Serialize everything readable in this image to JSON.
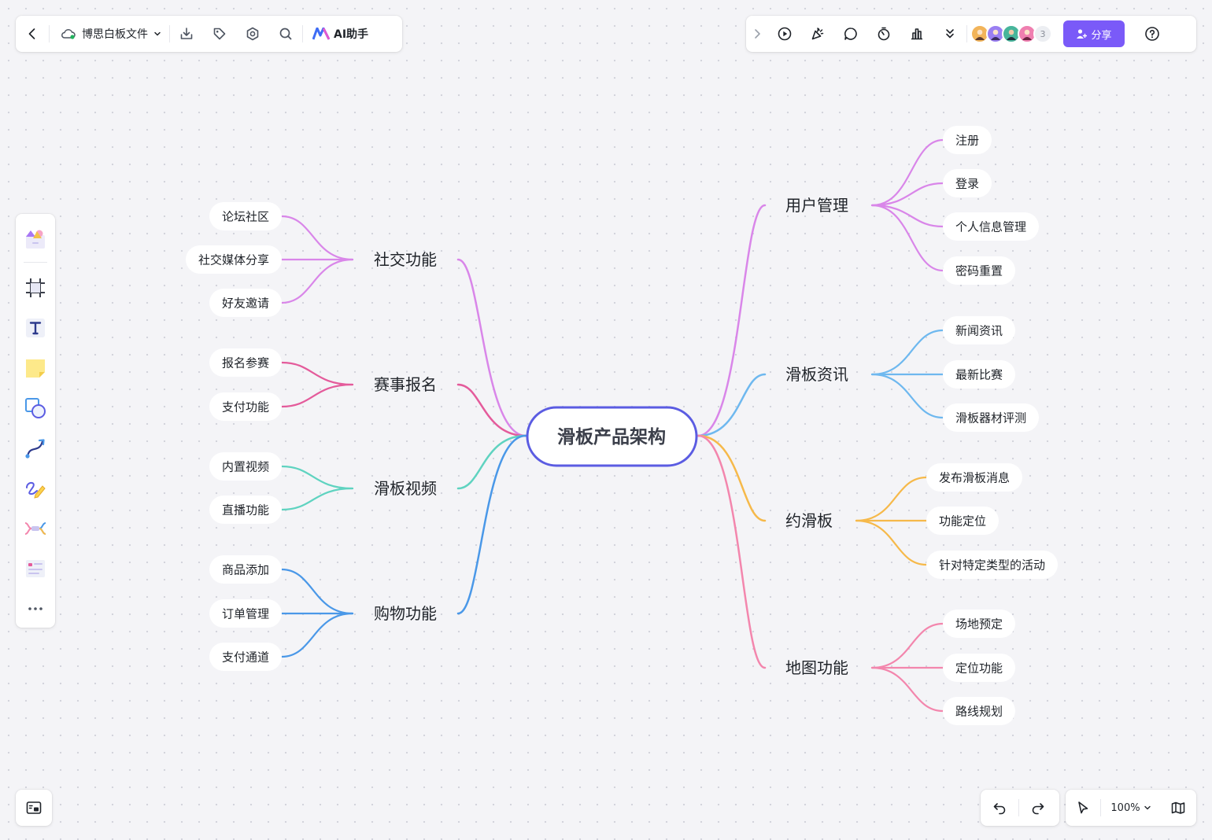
{
  "toolbar": {
    "file_title": "博思白板文件",
    "ai_label": "AI助手",
    "collaborator_count": "3",
    "share_label": "分享"
  },
  "zoom": {
    "level": "100%"
  },
  "colors": {
    "accent": "#7a5af8",
    "root_border": "#5b5ce2",
    "social": "#d986e9",
    "event": "#e45b9b",
    "video": "#5fd3c0",
    "shopping": "#4a98e8",
    "user": "#d986e9",
    "news": "#6eb8ef",
    "meetup": "#f6b94a",
    "map": "#f386ad"
  },
  "icons": {
    "toolbar_left": [
      "back-icon",
      "cloud-icon",
      "chevron-down-icon",
      "download-icon",
      "tag-icon",
      "settings-icon",
      "search-icon",
      "ai-logo-icon"
    ],
    "toolbar_right": [
      "expand-icon",
      "play-icon",
      "celebrate-icon",
      "comment-icon",
      "timer-icon",
      "chart-icon",
      "more-down-icon",
      "share-user-icon",
      "help-icon"
    ],
    "tools": [
      "template-icon",
      "frame-icon",
      "text-icon",
      "sticky-note-icon",
      "shape-icon",
      "connector-icon",
      "pen-icon",
      "mindmap-icon",
      "table-icon",
      "more-icon"
    ],
    "bottom": [
      "minimap-icon",
      "undo-icon",
      "redo-icon",
      "pointer-icon",
      "chevron-down-icon",
      "book-icon"
    ]
  },
  "mindmap": {
    "root": "滑板产品架构",
    "left": [
      {
        "label": "社交功能",
        "color": "#d986e9",
        "children": [
          "论坛社区",
          "社交媒体分享",
          "好友邀请"
        ]
      },
      {
        "label": "赛事报名",
        "color": "#e45b9b",
        "children": [
          "报名参赛",
          "支付功能"
        ]
      },
      {
        "label": "滑板视频",
        "color": "#5fd3c0",
        "children": [
          "内置视频",
          "直播功能"
        ]
      },
      {
        "label": "购物功能",
        "color": "#4a98e8",
        "children": [
          "商品添加",
          "订单管理",
          "支付通道"
        ]
      }
    ],
    "right": [
      {
        "label": "用户管理",
        "color": "#d986e9",
        "children": [
          "注册",
          "登录",
          "个人信息管理",
          "密码重置"
        ]
      },
      {
        "label": "滑板资讯",
        "color": "#6eb8ef",
        "children": [
          "新闻资讯",
          "最新比赛",
          "滑板器材评测"
        ]
      },
      {
        "label": "约滑板",
        "color": "#f6b94a",
        "children": [
          "发布滑板消息",
          "功能定位",
          "针对特定类型的活动"
        ]
      },
      {
        "label": "地图功能",
        "color": "#f386ad",
        "children": [
          "场地预定",
          "定位功能",
          "路线规划"
        ]
      }
    ]
  }
}
